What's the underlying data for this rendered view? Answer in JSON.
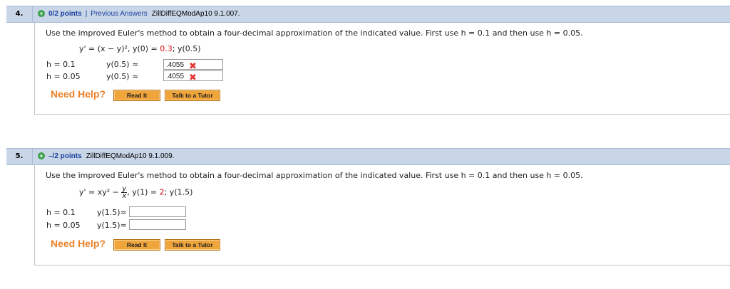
{
  "question4": {
    "number": "4.",
    "points": "0/2 points",
    "separator": "|",
    "previous_answers": "Previous Answers",
    "code": "ZillDiffEQModAp10 9.1.007.",
    "prompt": "Use the improved Euler's method to obtain a four-decimal approximation of the indicated value. First use h = 0.1 and then use h = 0.05.",
    "equation_prefix": "y' = (x − y)², y(0) = ",
    "equation_value": "0.3",
    "equation_suffix": "; y(0.5)",
    "row1_h": "h = 0.1",
    "row1_y": "y(0.5) ≈",
    "row1_answer": ".4055",
    "row2_h": "h = 0.05",
    "row2_y": "y(0.5) ≈",
    "row2_answer": ".4055",
    "incorrect_mark": "✖"
  },
  "question5": {
    "number": "5.",
    "points": "–/2 points",
    "code": "ZillDiffEQModAp10 9.1.009.",
    "prompt": "Use the improved Euler's method to obtain a four-decimal approximation of the indicated value. First use h = 0.1 and then use h = 0.05.",
    "equation_prefix": "y' = xy² − ",
    "frac_num": "y",
    "frac_den": "x",
    "equation_mid": ", y(1) = ",
    "equation_value": "2",
    "equation_suffix": "; y(1.5)",
    "row1_h": "h = 0.1",
    "row1_y": "y(1.5)≈",
    "row1_answer": "",
    "row2_h": "h = 0.05",
    "row2_y": "y(1.5)≈",
    "row2_answer": ""
  },
  "help": {
    "need_help": "Need Help?",
    "read_it": "Read It",
    "talk_to_tutor": "Talk to a Tutor"
  },
  "colors": {
    "header_bar": "#c9d6e8",
    "points_link": "#1b3f9e",
    "need_help": "#e9822a",
    "button": "#f0a53a",
    "incorrect": "#e23838",
    "given_value": "#d11111"
  }
}
